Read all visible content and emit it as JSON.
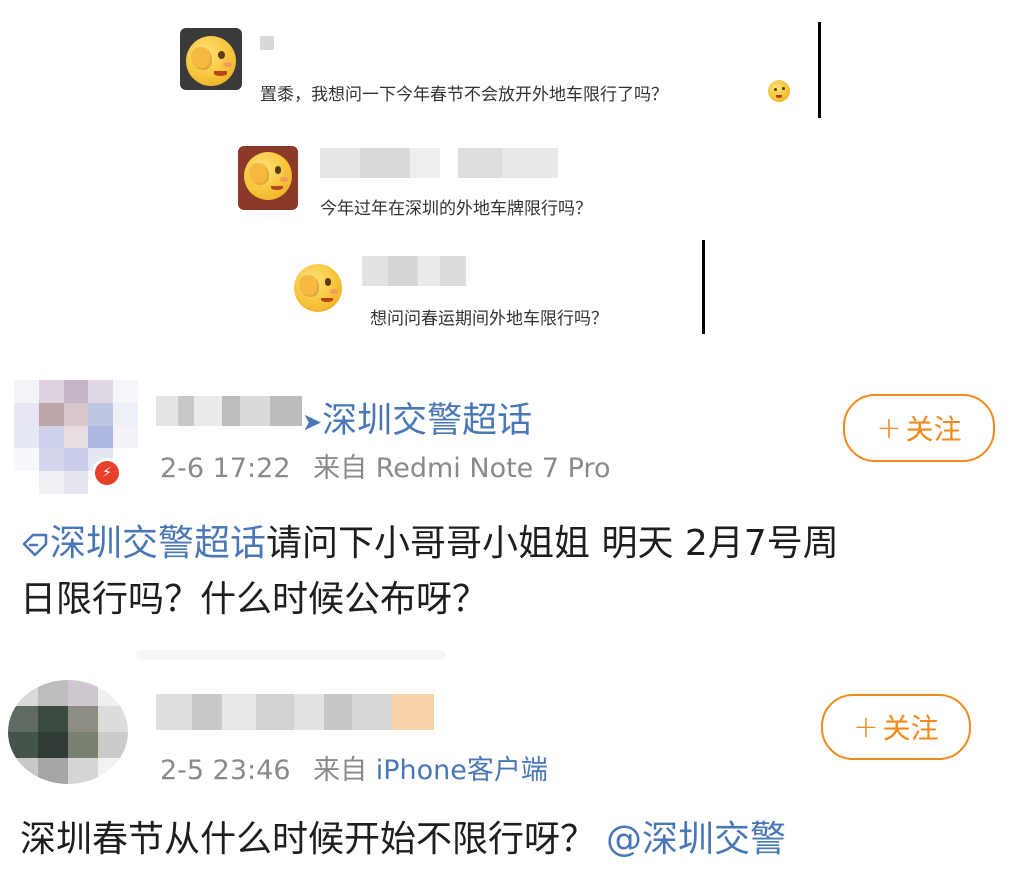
{
  "snippets": [
    {
      "text": "置黍，我想问一下今年春节不会放开外地车限行了吗？"
    },
    {
      "text": "今年过年在深圳的外地车牌限行吗？"
    },
    {
      "text": "想问问春运期间外地车限行吗？"
    }
  ],
  "posts": [
    {
      "topic_tag": "深圳交警超话",
      "time": "2-6 17:22",
      "source_prefix": "来自",
      "source": "Redmi Note 7 Pro",
      "follow_label": "关注",
      "body_topic": "深圳交警超话",
      "body_text_line1": "请问下小哥哥小姐姐 明天 2月7号周",
      "body_text_line2": "日限行吗？什么时候公布呀？",
      "badge_icon": "verified-badge-icon"
    },
    {
      "time": "2-5 23:46",
      "source_prefix": "来自",
      "source": "iPhone客户端",
      "follow_label": "关注",
      "body_text": "深圳春节从什么时候开始不限行呀？",
      "mention": "@深圳交警"
    }
  ],
  "colors": {
    "link_blue": "#4a77b5",
    "follow_orange": "#f08a1c",
    "meta_gray": "#8a8a8a",
    "badge_red": "#e8412b"
  }
}
